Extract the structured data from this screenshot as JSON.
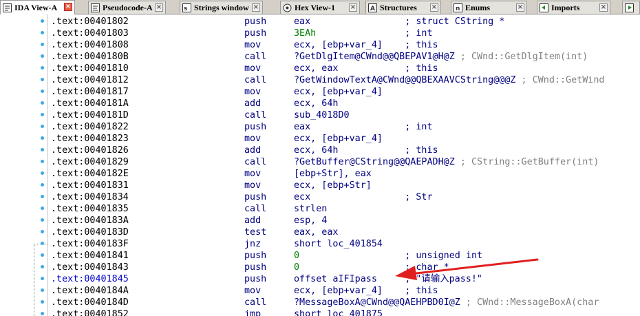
{
  "tabs": [
    {
      "label": "IDA View-A",
      "icon": "disassembly-view-icon",
      "active": true
    },
    {
      "label": "Pseudocode-A",
      "icon": "pseudocode-icon",
      "active": false
    },
    {
      "label": "Strings window",
      "icon": "strings-icon",
      "active": false
    },
    {
      "label": "Hex View-1",
      "icon": "hex-view-icon",
      "active": false
    },
    {
      "label": "Structures",
      "icon": "structures-icon",
      "active": false
    },
    {
      "label": "Enums",
      "icon": "enums-icon",
      "active": false
    },
    {
      "label": "Imports",
      "icon": "imports-icon",
      "active": false
    },
    {
      "label": "",
      "icon": "exports-icon",
      "active": false
    }
  ],
  "tab_close_glyph": "×",
  "colors": {
    "address": "#000000",
    "highlight_address": "#0000cc",
    "instruction": "#000080",
    "number": "#008000",
    "comment_gray": "#808080",
    "gutter_dot": "#3da9e8",
    "annotation_arrow": "#e02020"
  },
  "lines": [
    {
      "addr": ".text:00401802",
      "mn": "push",
      "op": "eax",
      "cm": "; struct CString *"
    },
    {
      "addr": ".text:00401803",
      "mn": "push",
      "op": "3EAh",
      "cm": "; int"
    },
    {
      "addr": ".text:00401808",
      "mn": "mov",
      "op": "ecx, [ebp+var_4]",
      "cm": "; this"
    },
    {
      "addr": ".text:0040180B",
      "mn": "call",
      "op": "?GetDlgItem@CWnd@@QBEPAV1@H@Z",
      "cm": "; CWnd::GetDlgItem(int)"
    },
    {
      "addr": ".text:00401810",
      "mn": "mov",
      "op": "ecx, eax",
      "cm": "; this"
    },
    {
      "addr": ".text:00401812",
      "mn": "call",
      "op": "?GetWindowTextA@CWnd@@QBEXAAVCString@@@Z",
      "cm": "; CWnd::GetWind"
    },
    {
      "addr": ".text:00401817",
      "mn": "mov",
      "op": "ecx, [ebp+var_4]",
      "cm": ""
    },
    {
      "addr": ".text:0040181A",
      "mn": "add",
      "op": "ecx, 64h",
      "cm": ""
    },
    {
      "addr": ".text:0040181D",
      "mn": "call",
      "op": "sub_4018D0",
      "cm": ""
    },
    {
      "addr": ".text:00401822",
      "mn": "push",
      "op": "eax",
      "cm": "; int"
    },
    {
      "addr": ".text:00401823",
      "mn": "mov",
      "op": "ecx, [ebp+var_4]",
      "cm": ""
    },
    {
      "addr": ".text:00401826",
      "mn": "add",
      "op": "ecx, 64h",
      "cm": "; this"
    },
    {
      "addr": ".text:00401829",
      "mn": "call",
      "op": "?GetBuffer@CString@@QAEPADH@Z",
      "cm": "; CString::GetBuffer(int)"
    },
    {
      "addr": ".text:0040182E",
      "mn": "mov",
      "op": "[ebp+Str], eax",
      "cm": ""
    },
    {
      "addr": ".text:00401831",
      "mn": "mov",
      "op": "ecx, [ebp+Str]",
      "cm": ""
    },
    {
      "addr": ".text:00401834",
      "mn": "push",
      "op": "ecx",
      "cm": "; Str"
    },
    {
      "addr": ".text:00401835",
      "mn": "call",
      "op": "strlen",
      "cm": ""
    },
    {
      "addr": ".text:0040183A",
      "mn": "add",
      "op": "esp, 4",
      "cm": ""
    },
    {
      "addr": ".text:0040183D",
      "mn": "test",
      "op": "eax, eax",
      "cm": ""
    },
    {
      "addr": ".text:0040183F",
      "mn": "jnz",
      "op": "short loc_401854",
      "cm": ""
    },
    {
      "addr": ".text:00401841",
      "mn": "push",
      "op": "0",
      "cm": "; unsigned int"
    },
    {
      "addr": ".text:00401843",
      "mn": "push",
      "op": "0",
      "cm": "; char *"
    },
    {
      "addr": ".text:00401845",
      "mn": "push",
      "op": "offset aIFIpass",
      "cm": "; \"请输入pass!\""
    },
    {
      "addr": ".text:0040184A",
      "mn": "mov",
      "op": "ecx, [ebp+var_4]",
      "cm": "; this"
    },
    {
      "addr": ".text:0040184D",
      "mn": "call",
      "op": "?MessageBoxA@CWnd@@QAEHPBD0I@Z",
      "cm": "; CWnd::MessageBoxA(char"
    },
    {
      "addr": ".text:00401852",
      "mn": "jmp",
      "op": "short loc_401875",
      "cm": ""
    }
  ]
}
